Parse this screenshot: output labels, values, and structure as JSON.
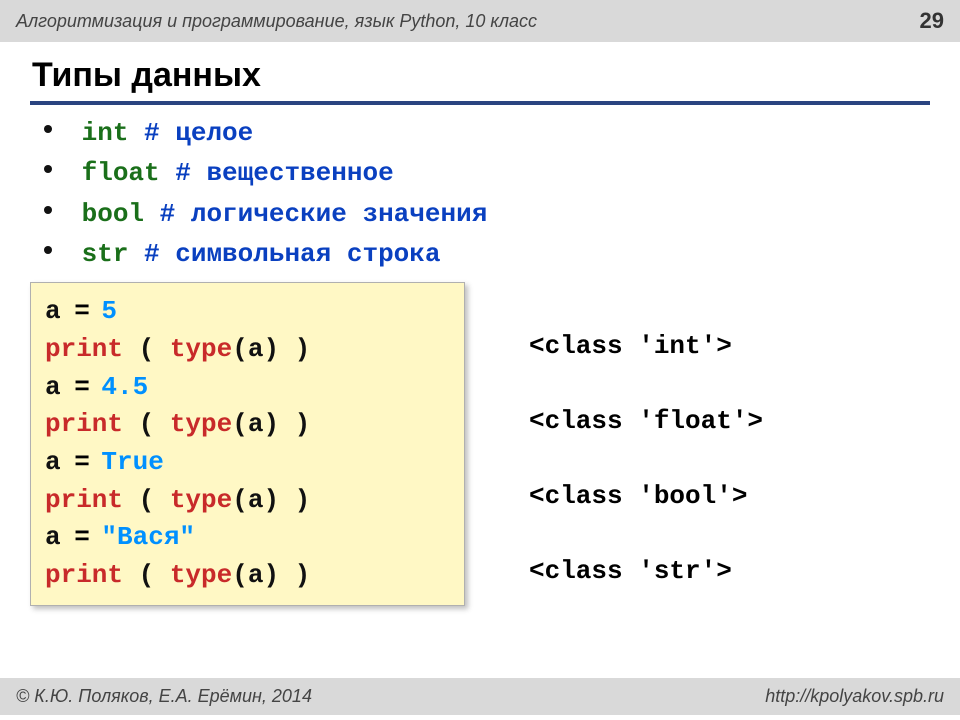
{
  "header": {
    "breadcrumb": "Алгоритмизация и программирование, язык Python, 10 класс",
    "page_number": "29"
  },
  "title": "Типы данных",
  "types": [
    {
      "keyword": "int",
      "spacer": "    ",
      "comment": "# целое"
    },
    {
      "keyword": "float",
      "spacer": "  ",
      "comment": "# вещественное"
    },
    {
      "keyword": "bool",
      "spacer": "     ",
      "comment": "# логические значения"
    },
    {
      "keyword": "str",
      "spacer": "  ",
      "comment": "# символьная строка"
    }
  ],
  "code_lines": [
    {
      "left": "a",
      "eq": " = ",
      "val": "5"
    },
    {
      "call": "print",
      "open": " ( ",
      "fn": "type",
      "arg": "(a)",
      "close": " )"
    },
    {
      "left": "a",
      "eq": " = ",
      "val": "4.5"
    },
    {
      "call": "print",
      "open": " ( ",
      "fn": "type",
      "arg": "(a)",
      "close": " )"
    },
    {
      "left": "a",
      "eq": " = ",
      "val": "True"
    },
    {
      "call": "print",
      "open": " ( ",
      "fn": "type",
      "arg": "(a)",
      "close": " )"
    },
    {
      "left": "a",
      "eq": " = ",
      "val": "\"Вася\""
    },
    {
      "call": "print",
      "open": " ( ",
      "fn": "type",
      "arg": "(a)",
      "close": " )"
    }
  ],
  "outputs": [
    "<class 'int'>",
    "<class 'float'>",
    "<class 'bool'>",
    "<class 'str'>"
  ],
  "footer": {
    "credit": "© К.Ю. Поляков, Е.А. Ерёмин, 2014",
    "url": "http://kpolyakov.spb.ru"
  }
}
